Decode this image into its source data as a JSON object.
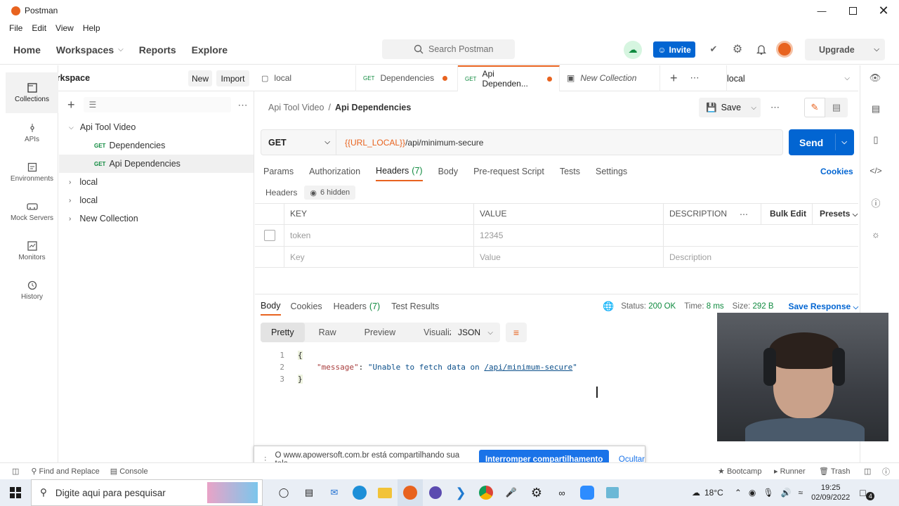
{
  "window": {
    "title": "Postman",
    "menu": [
      "File",
      "Edit",
      "View",
      "Help"
    ]
  },
  "header": {
    "nav": [
      "Home",
      "Workspaces",
      "Reports",
      "Explore"
    ],
    "search_placeholder": "Search Postman",
    "invite": "Invite",
    "upgrade": "Upgrade"
  },
  "workspace": {
    "name": "My Workspace",
    "new_label": "New",
    "import_label": "Import"
  },
  "rail": [
    {
      "label": "Collections",
      "icon": "collections-icon"
    },
    {
      "label": "APIs",
      "icon": "apis-icon"
    },
    {
      "label": "Environments",
      "icon": "environments-icon"
    },
    {
      "label": "Mock Servers",
      "icon": "mock-servers-icon"
    },
    {
      "label": "Monitors",
      "icon": "monitors-icon"
    },
    {
      "label": "History",
      "icon": "history-icon"
    }
  ],
  "tree": {
    "root": "Api Tool Video",
    "children": [
      {
        "method": "GET",
        "name": "Dependencies"
      },
      {
        "method": "GET",
        "name": "Api Dependencies"
      }
    ],
    "others": [
      "local",
      "local",
      "New Collection"
    ]
  },
  "tabs": [
    {
      "method": "",
      "name": "local",
      "dot": false
    },
    {
      "method": "GET",
      "name": "Dependencies",
      "dot": true
    },
    {
      "method": "GET",
      "name": "Api Dependen...",
      "dot": true
    },
    {
      "method": "",
      "name": "New Collection",
      "dot": false
    }
  ],
  "environment": "local",
  "breadcrumb": {
    "parent": "Api Tool Video",
    "sep": "/",
    "current": "Api Dependencies"
  },
  "save_label": "Save",
  "request": {
    "method": "GET",
    "url_var": "{{URL_LOCAL}}",
    "url_path": "/api/minimum-secure",
    "send": "Send"
  },
  "req_tabs": [
    "Params",
    "Authorization",
    "Headers",
    "(7)",
    "Body",
    "Pre-request Script",
    "Tests",
    "Settings"
  ],
  "cookies": "Cookies",
  "headers_section": {
    "label": "Headers",
    "hidden": "6 hidden"
  },
  "headers_table": {
    "cols": [
      "KEY",
      "VALUE",
      "DESCRIPTION"
    ],
    "bulk_edit": "Bulk Edit",
    "presets": "Presets",
    "rows": [
      {
        "key": "token",
        "value": "12345",
        "description": ""
      }
    ],
    "placeholder": {
      "key": "Key",
      "value": "Value",
      "description": "Description"
    }
  },
  "response": {
    "tabs": [
      "Body",
      "Cookies",
      "Headers",
      "(7)",
      "Test Results"
    ],
    "status_label": "Status:",
    "status": "200 OK",
    "time_label": "Time:",
    "time": "8 ms",
    "size_label": "Size:",
    "size": "292 B",
    "save_response": "Save Response",
    "view_modes": [
      "Pretty",
      "Raw",
      "Preview",
      "Visualize"
    ],
    "format": "JSON",
    "lines": [
      {
        "n": "1",
        "text": "{"
      },
      {
        "n": "2",
        "key": "\"message\"",
        "colon": ": ",
        "value_pre": "\"Unable to fetch data on ",
        "value_link": "/api/minimum-secure",
        "value_post": "\""
      },
      {
        "n": "3",
        "text": "}"
      }
    ]
  },
  "share_banner": {
    "text": "O www.apowersoft.com.br está compartilhando sua tela.",
    "stop": "Interromper compartilhamento",
    "hide": "Ocultar"
  },
  "bottombar": {
    "find": "Find and Replace",
    "console": "Console",
    "bootcamp": "Bootcamp",
    "runner": "Runner",
    "trash": "Trash"
  },
  "taskbar": {
    "search": "Digite aqui para pesquisar",
    "temp": "18°C",
    "time": "19:25",
    "date": "02/09/2022",
    "notif": "4"
  },
  "colors": {
    "accent": "#e8631f",
    "primary": "#0265d2",
    "get": "#0f8a3f"
  }
}
